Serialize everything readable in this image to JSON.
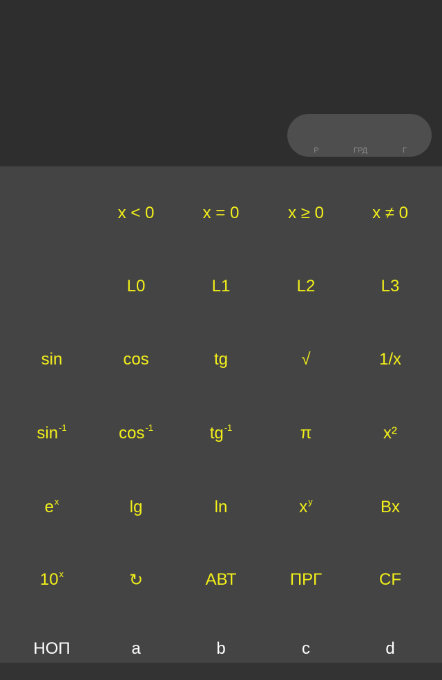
{
  "display": {
    "angle_modes": [
      "Р",
      "ГРД",
      "Г"
    ]
  },
  "keypad": {
    "rows": [
      [
        null,
        {
          "name": "x-less-zero-key",
          "label": "x < 0"
        },
        {
          "name": "x-equal-zero-key",
          "label": "x = 0"
        },
        {
          "name": "x-greater-equal-zero-key",
          "label": "x ≥ 0"
        },
        {
          "name": "x-not-equal-zero-key",
          "label": "x ≠ 0"
        }
      ],
      [
        null,
        {
          "name": "l0-key",
          "label": "L0"
        },
        {
          "name": "l1-key",
          "label": "L1"
        },
        {
          "name": "l2-key",
          "label": "L2"
        },
        {
          "name": "l3-key",
          "label": "L3"
        }
      ],
      [
        {
          "name": "sin-key",
          "label": "sin"
        },
        {
          "name": "cos-key",
          "label": "cos"
        },
        {
          "name": "tg-key",
          "label": "tg"
        },
        {
          "name": "sqrt-key",
          "label": "√"
        },
        {
          "name": "reciprocal-key",
          "label": "1/x"
        }
      ],
      [
        {
          "name": "arcsin-key",
          "label": "sin",
          "sup": "-1"
        },
        {
          "name": "arccos-key",
          "label": "cos",
          "sup": "-1"
        },
        {
          "name": "arctg-key",
          "label": "tg",
          "sup": "-1"
        },
        {
          "name": "pi-key",
          "label": "π"
        },
        {
          "name": "square-key",
          "label": "x²"
        }
      ],
      [
        {
          "name": "exp-key",
          "label": "e",
          "sup": "x"
        },
        {
          "name": "lg-key",
          "label": "lg"
        },
        {
          "name": "ln-key",
          "label": "ln"
        },
        {
          "name": "power-key",
          "label": "x",
          "sup": "y"
        },
        {
          "name": "bx-key",
          "label": "Bx"
        }
      ],
      [
        {
          "name": "ten-power-key",
          "label": "10",
          "sup": "x"
        },
        {
          "name": "rotate-key",
          "label": "↻"
        },
        {
          "name": "avt-key",
          "label": "АВТ"
        },
        {
          "name": "prg-key",
          "label": "ПРГ"
        },
        {
          "name": "cf-key",
          "label": "CF"
        }
      ],
      [
        {
          "name": "nop-key",
          "label": "НОП",
          "color": "white"
        },
        {
          "name": "a-key",
          "label": "a",
          "color": "white"
        },
        {
          "name": "b-key",
          "label": "b",
          "color": "white"
        },
        {
          "name": "c-key",
          "label": "c",
          "color": "white"
        },
        {
          "name": "d-key",
          "label": "d",
          "color": "white"
        }
      ]
    ]
  },
  "colors": {
    "key_text": "#f2ef1a",
    "key_text_alt": "#ffffff",
    "display_bg": "#2e2e2e",
    "keypad_bg": "#444444"
  }
}
